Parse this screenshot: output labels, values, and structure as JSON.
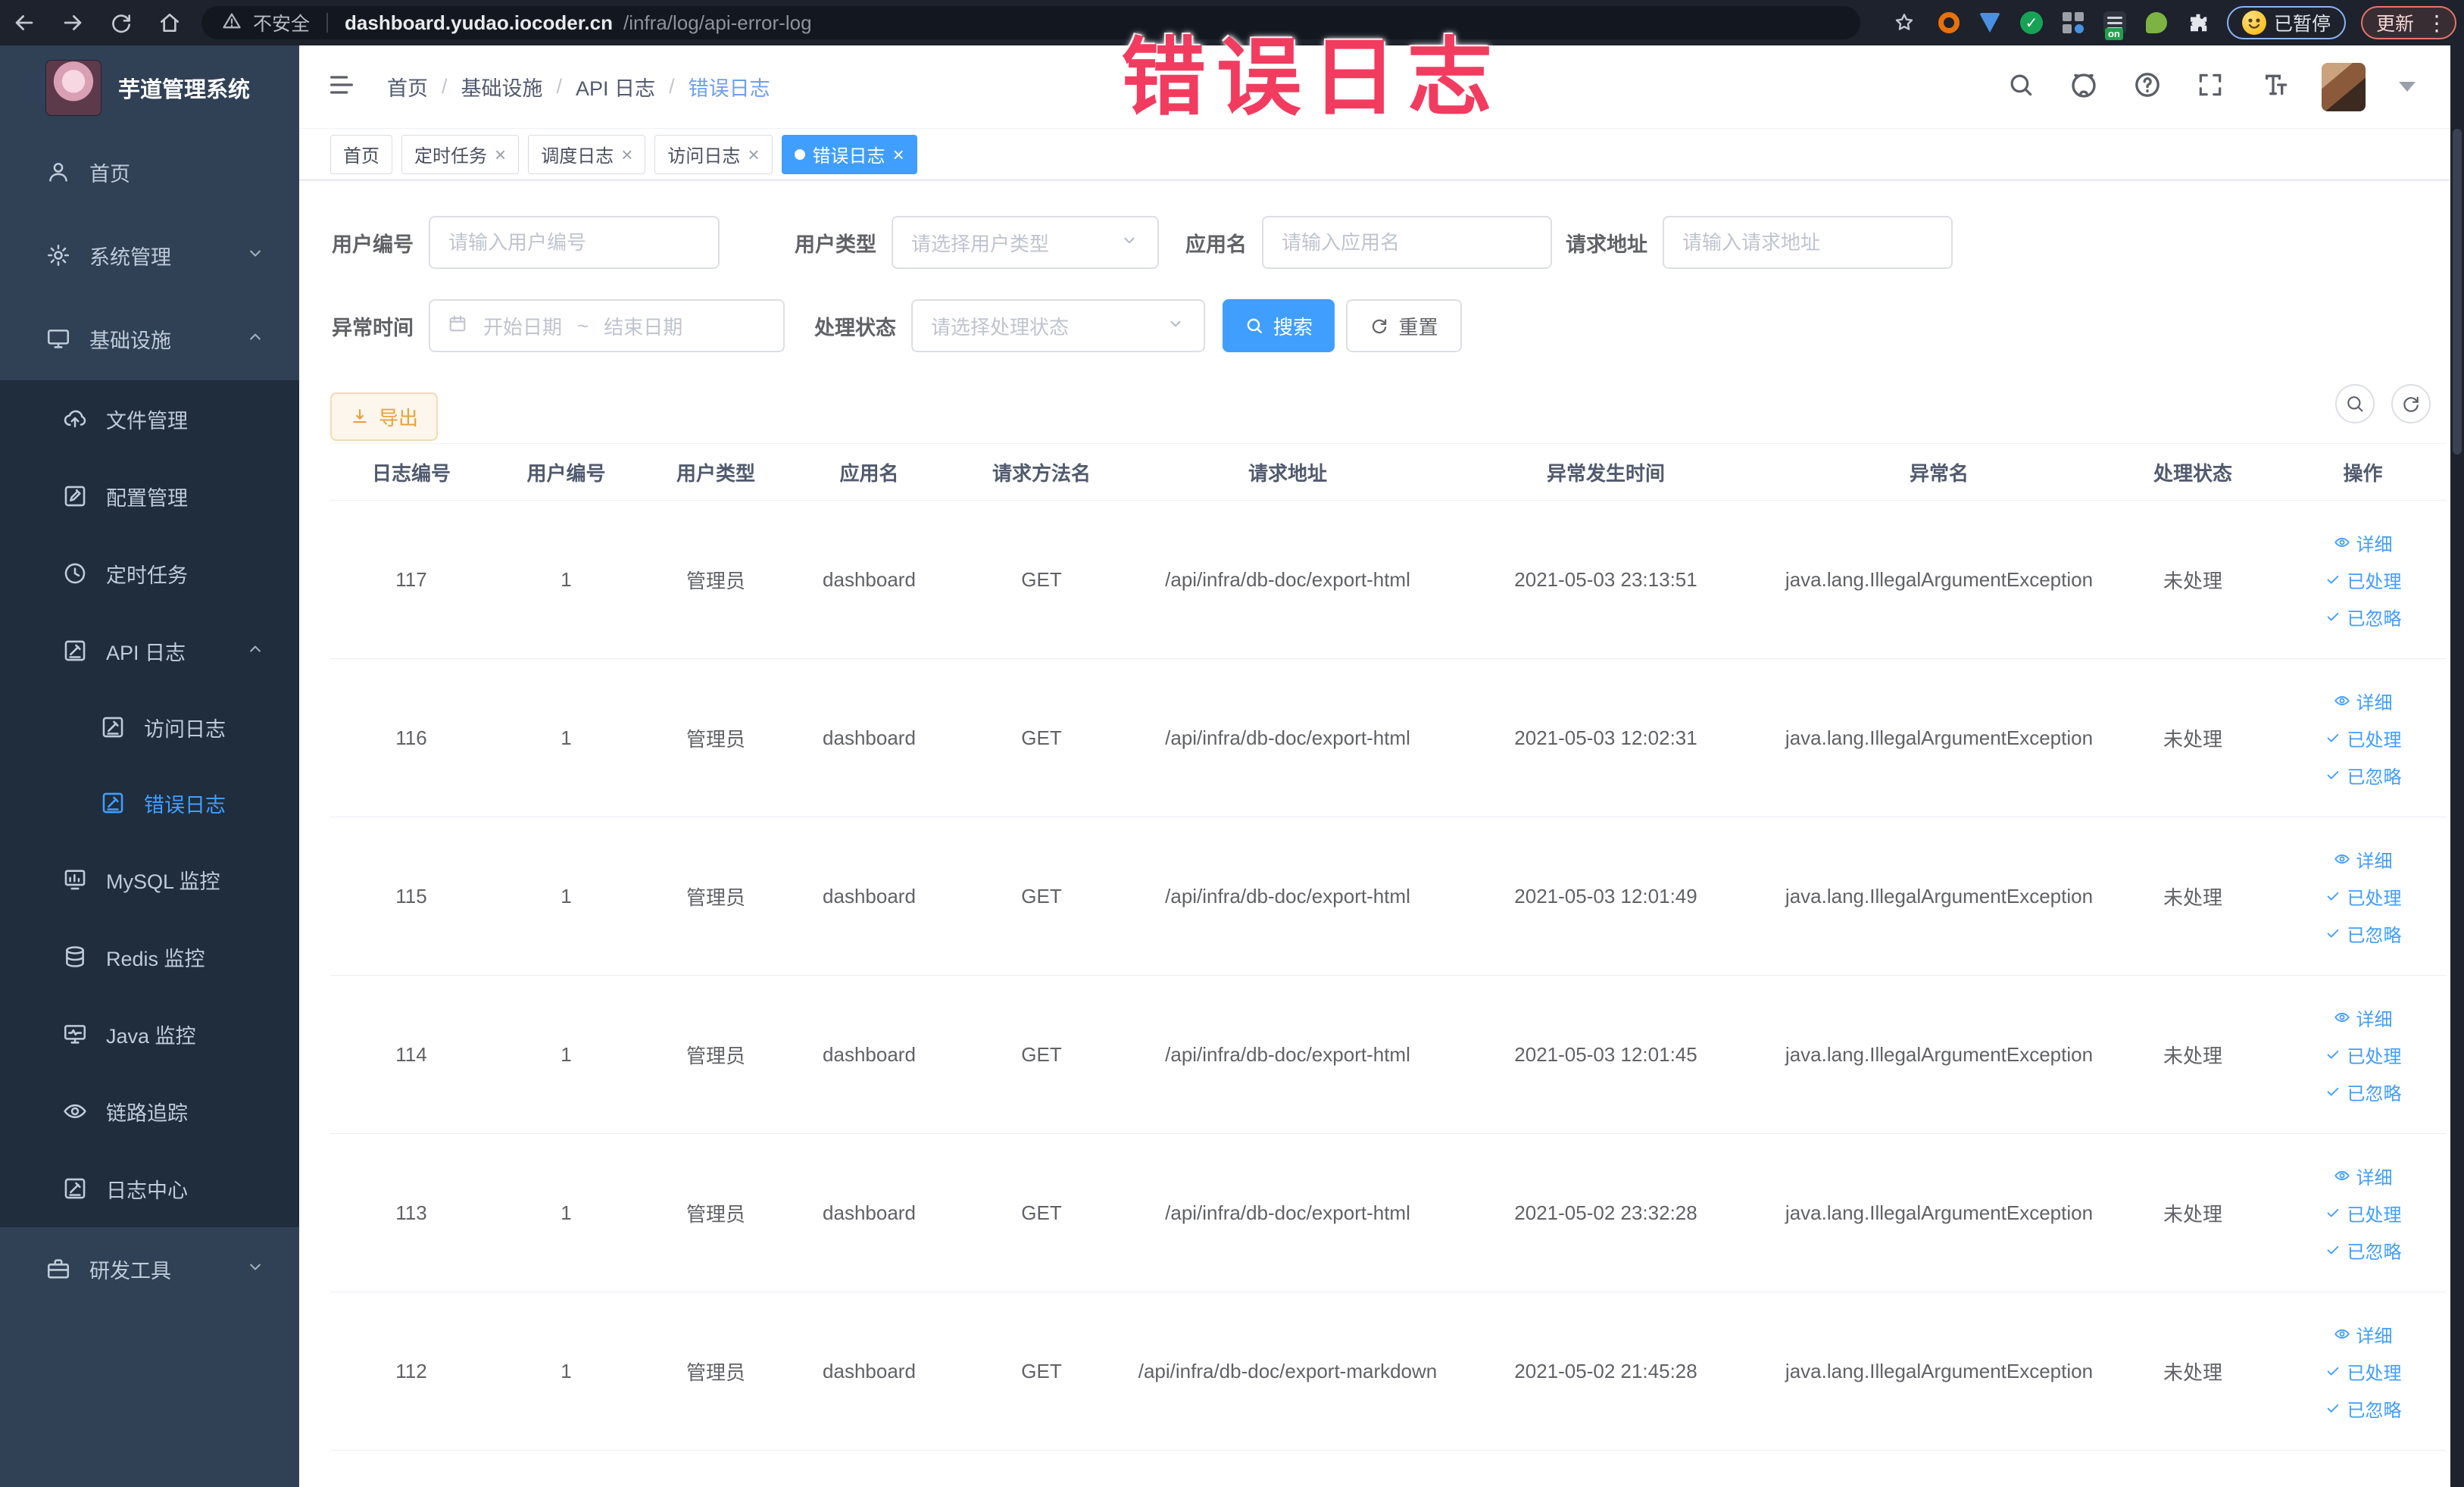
{
  "browser": {
    "security_label": "不安全",
    "url_host": "dashboard.yudao.iocoder.cn",
    "url_path": "/infra/log/api-error-log",
    "profile_status": "已暂停",
    "update_label": "更新",
    "extension_badge": "on"
  },
  "overlay_title": "错误日志",
  "colors": {
    "accent": "#409eff",
    "warning": "#e6a23c",
    "overlay_red": "#f23c5f",
    "sidebar_bg": "#304156",
    "submenu_bg": "#1f2d3d"
  },
  "sidebar": {
    "logo_title": "芋道管理系统",
    "items": [
      {
        "label": "首页",
        "icon": "home-icon",
        "level": 1
      },
      {
        "label": "系统管理",
        "icon": "gear-icon",
        "level": 1,
        "chevron": "down"
      },
      {
        "label": "基础设施",
        "icon": "monitor-icon",
        "level": 1,
        "chevron": "up"
      },
      {
        "label": "文件管理",
        "icon": "upload-icon",
        "level": 2,
        "group": "infra"
      },
      {
        "label": "配置管理",
        "icon": "edit-icon",
        "level": 2,
        "group": "infra"
      },
      {
        "label": "定时任务",
        "icon": "clock-icon",
        "level": 2,
        "group": "infra"
      },
      {
        "label": "API 日志",
        "icon": "log-icon",
        "level": 2,
        "group": "infra",
        "chevron": "up"
      },
      {
        "label": "访问日志",
        "icon": "log-icon",
        "level": 3,
        "group": "infra"
      },
      {
        "label": "错误日志",
        "icon": "log-icon",
        "level": 3,
        "group": "infra",
        "active": true
      },
      {
        "label": "MySQL 监控",
        "icon": "chart-icon",
        "level": 2,
        "group": "infra"
      },
      {
        "label": "Redis 监控",
        "icon": "database-icon",
        "level": 2,
        "group": "infra"
      },
      {
        "label": "Java 监控",
        "icon": "java-icon",
        "level": 2,
        "group": "infra"
      },
      {
        "label": "链路追踪",
        "icon": "eye-icon",
        "level": 2,
        "group": "infra"
      },
      {
        "label": "日志中心",
        "icon": "log-icon",
        "level": 2,
        "group": "infra"
      },
      {
        "label": "研发工具",
        "icon": "toolbox-icon",
        "level": 1,
        "chevron": "down"
      }
    ]
  },
  "breadcrumb": [
    "首页",
    "基础设施",
    "API 日志",
    "错误日志"
  ],
  "tabs": [
    {
      "label": "首页",
      "closable": false,
      "active": false
    },
    {
      "label": "定时任务",
      "closable": true,
      "active": false
    },
    {
      "label": "调度日志",
      "closable": true,
      "active": false
    },
    {
      "label": "访问日志",
      "closable": true,
      "active": false
    },
    {
      "label": "错误日志",
      "closable": true,
      "active": true
    }
  ],
  "filters": {
    "user_id": {
      "label": "用户编号",
      "placeholder": "请输入用户编号"
    },
    "user_type": {
      "label": "用户类型",
      "placeholder": "请选择用户类型"
    },
    "app_name": {
      "label": "应用名",
      "placeholder": "请输入应用名"
    },
    "request_url": {
      "label": "请求地址",
      "placeholder": "请输入请求地址"
    },
    "exception_time": {
      "label": "异常时间",
      "start_placeholder": "开始日期",
      "separator": "~",
      "end_placeholder": "结束日期"
    },
    "process_status": {
      "label": "处理状态",
      "placeholder": "请选择处理状态"
    },
    "search_label": "搜索",
    "reset_label": "重置"
  },
  "toolbar": {
    "export_label": "导出"
  },
  "table": {
    "columns": [
      "日志编号",
      "用户编号",
      "用户类型",
      "应用名",
      "请求方法名",
      "请求地址",
      "异常发生时间",
      "异常名",
      "处理状态",
      "操作"
    ],
    "actions": [
      "详细",
      "已处理",
      "已忽略"
    ],
    "rows": [
      {
        "id": "117",
        "user_id": "1",
        "user_type": "管理员",
        "app": "dashboard",
        "method": "GET",
        "url": "/api/infra/db-doc/export-html",
        "time": "2021-05-03 23:13:51",
        "exception": "java.lang.IllegalArgumentException",
        "status": "未处理"
      },
      {
        "id": "116",
        "user_id": "1",
        "user_type": "管理员",
        "app": "dashboard",
        "method": "GET",
        "url": "/api/infra/db-doc/export-html",
        "time": "2021-05-03 12:02:31",
        "exception": "java.lang.IllegalArgumentException",
        "status": "未处理"
      },
      {
        "id": "115",
        "user_id": "1",
        "user_type": "管理员",
        "app": "dashboard",
        "method": "GET",
        "url": "/api/infra/db-doc/export-html",
        "time": "2021-05-03 12:01:49",
        "exception": "java.lang.IllegalArgumentException",
        "status": "未处理"
      },
      {
        "id": "114",
        "user_id": "1",
        "user_type": "管理员",
        "app": "dashboard",
        "method": "GET",
        "url": "/api/infra/db-doc/export-html",
        "time": "2021-05-03 12:01:45",
        "exception": "java.lang.IllegalArgumentException",
        "status": "未处理"
      },
      {
        "id": "113",
        "user_id": "1",
        "user_type": "管理员",
        "app": "dashboard",
        "method": "GET",
        "url": "/api/infra/db-doc/export-html",
        "time": "2021-05-02 23:32:28",
        "exception": "java.lang.IllegalArgumentException",
        "status": "未处理"
      },
      {
        "id": "112",
        "user_id": "1",
        "user_type": "管理员",
        "app": "dashboard",
        "method": "GET",
        "url": "/api/infra/db-doc/export-markdown",
        "time": "2021-05-02 21:45:28",
        "exception": "java.lang.IllegalArgumentException",
        "status": "未处理"
      }
    ]
  }
}
